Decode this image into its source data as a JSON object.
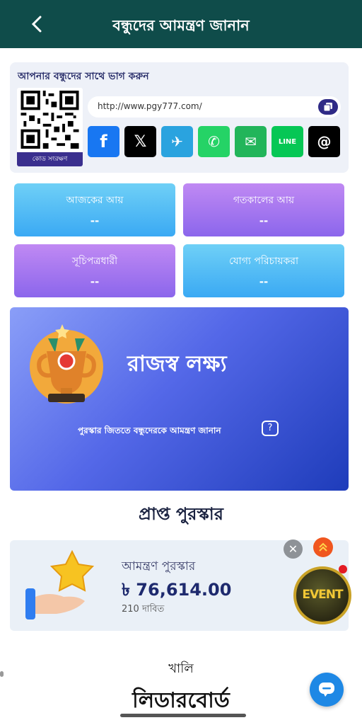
{
  "header": {
    "title": "বন্ধুদের আমন্ত্রণ জানান"
  },
  "share": {
    "title": "আপনার বন্ধুদের সাথে ভাগ করুন",
    "qr_save_label": "কোড সংরক্ষণ",
    "url": "http://www.pgy777.com/",
    "socials": [
      {
        "name": "facebook",
        "glyph": "f",
        "color": "#1877f2"
      },
      {
        "name": "x",
        "glyph": "𝕏",
        "color": "#000000"
      },
      {
        "name": "telegram",
        "glyph": "✈",
        "color": "#2aa3df"
      },
      {
        "name": "whatsapp",
        "glyph": "✆",
        "color": "#25d366"
      },
      {
        "name": "sms",
        "glyph": "✉",
        "color": "#22b55a"
      },
      {
        "name": "line",
        "glyph": "LINE",
        "color": "#06c755"
      },
      {
        "name": "threads",
        "glyph": "@",
        "color": "#000000"
      }
    ]
  },
  "stats": [
    {
      "label": "আজকের আয়",
      "value": "--"
    },
    {
      "label": "গতকালের আয়",
      "value": "--"
    },
    {
      "label": "সূচিপত্রধারী",
      "value": "--"
    },
    {
      "label": "যোগ্য পরিচায়করা",
      "value": "--"
    }
  ],
  "target": {
    "title": "রাজস্ব লক্ষ্য",
    "invite_text": "পুরস্কার জিততে বন্ধুদেরকে আমন্ত্রণ জানান",
    "help_glyph": "?"
  },
  "rewards_section_title": "প্রাপ্ত পুরস্কার",
  "reward": {
    "label": "আমন্ত্রণ পুরস্কার",
    "amount": "৳ 76,614.00",
    "claims": "210 দাবিত"
  },
  "event_label": "EVENT",
  "empty_text": "খালি",
  "leaderboard_title": "লিডারবোর্ড",
  "colors": {
    "header": "#0f4c4a",
    "accent": "#2f2a86"
  }
}
